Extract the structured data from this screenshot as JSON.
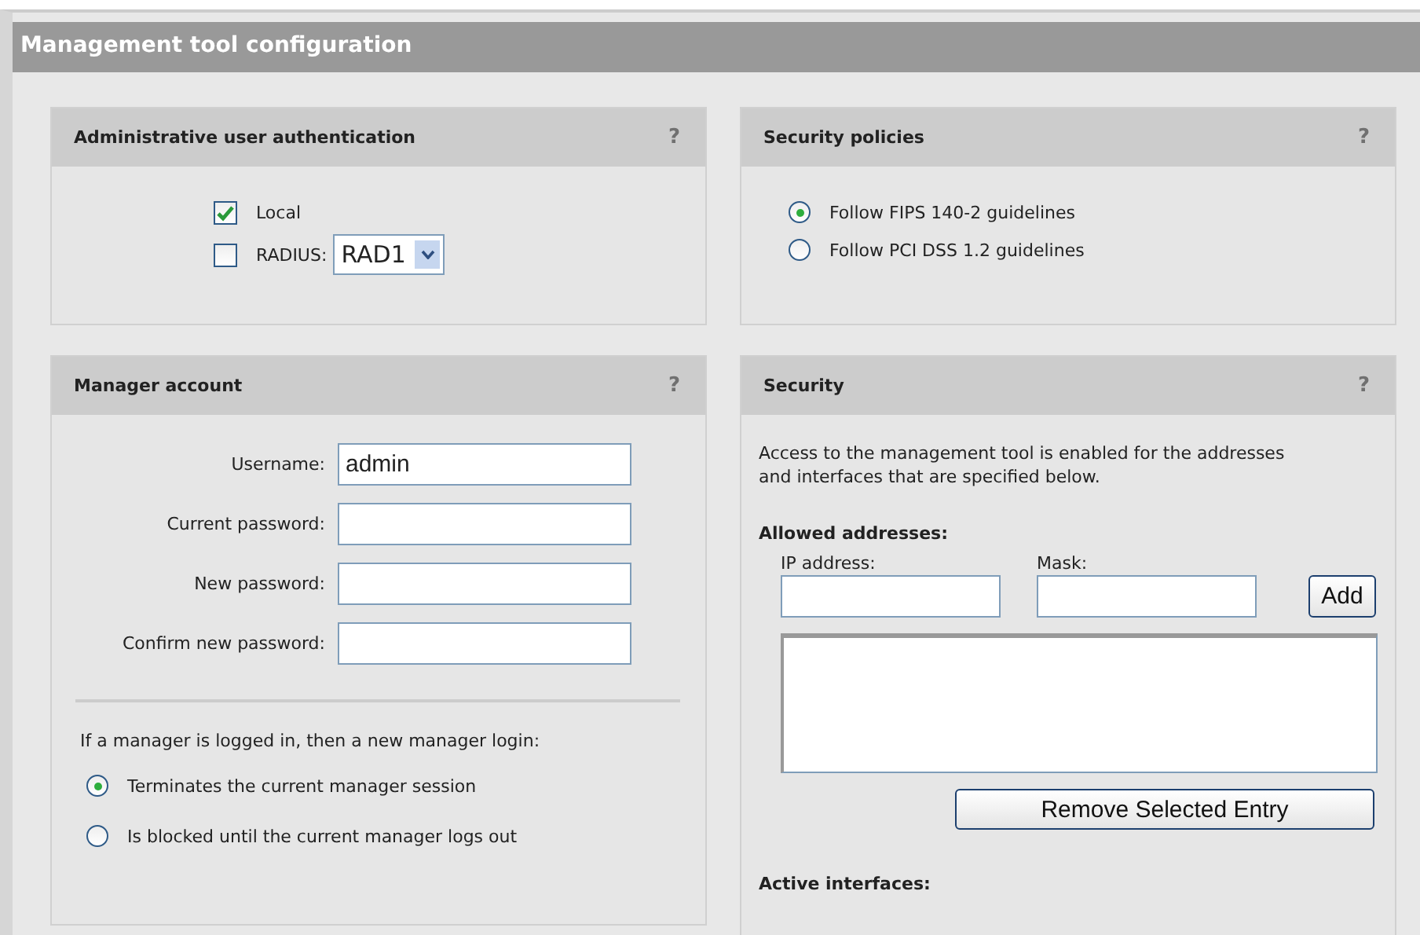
{
  "page": {
    "title": "Management tool configuration"
  },
  "auth": {
    "title": "Administrative user authentication",
    "help": "?",
    "options": [
      {
        "kind": "checkbox",
        "label": "Local",
        "checked": true
      },
      {
        "kind": "checkbox-select",
        "label": "RADIUS:",
        "checked": false,
        "value": "RAD1"
      }
    ]
  },
  "policies": {
    "title": "Security policies",
    "help": "?",
    "options": [
      {
        "label": "Follow FIPS 140-2 guidelines",
        "selected": true
      },
      {
        "label": "Follow PCI DSS 1.2 guidelines",
        "selected": false
      }
    ]
  },
  "manager": {
    "title": "Manager account",
    "help": "?",
    "fields": [
      {
        "label": "Username:",
        "value": "admin"
      },
      {
        "label": "Current password:"
      },
      {
        "label": "New password:"
      },
      {
        "label": "Confirm new password:"
      }
    ],
    "note": "If a manager is logged in, then a new manager login:",
    "options": [
      {
        "label": "Terminates the current manager session",
        "selected": true
      },
      {
        "label": "Is blocked until the current manager logs out",
        "selected": false
      }
    ]
  },
  "security": {
    "title": "Security",
    "help": "?",
    "description": "Access to the management tool is enabled for the addresses and interfaces that are specified below.",
    "allowed_heading": "Allowed addresses:",
    "ip_label": "IP address:",
    "mask_label": "Mask:",
    "add_button": "Add",
    "remove_button": "Remove Selected Entry",
    "active_heading": "Active interfaces:"
  }
}
